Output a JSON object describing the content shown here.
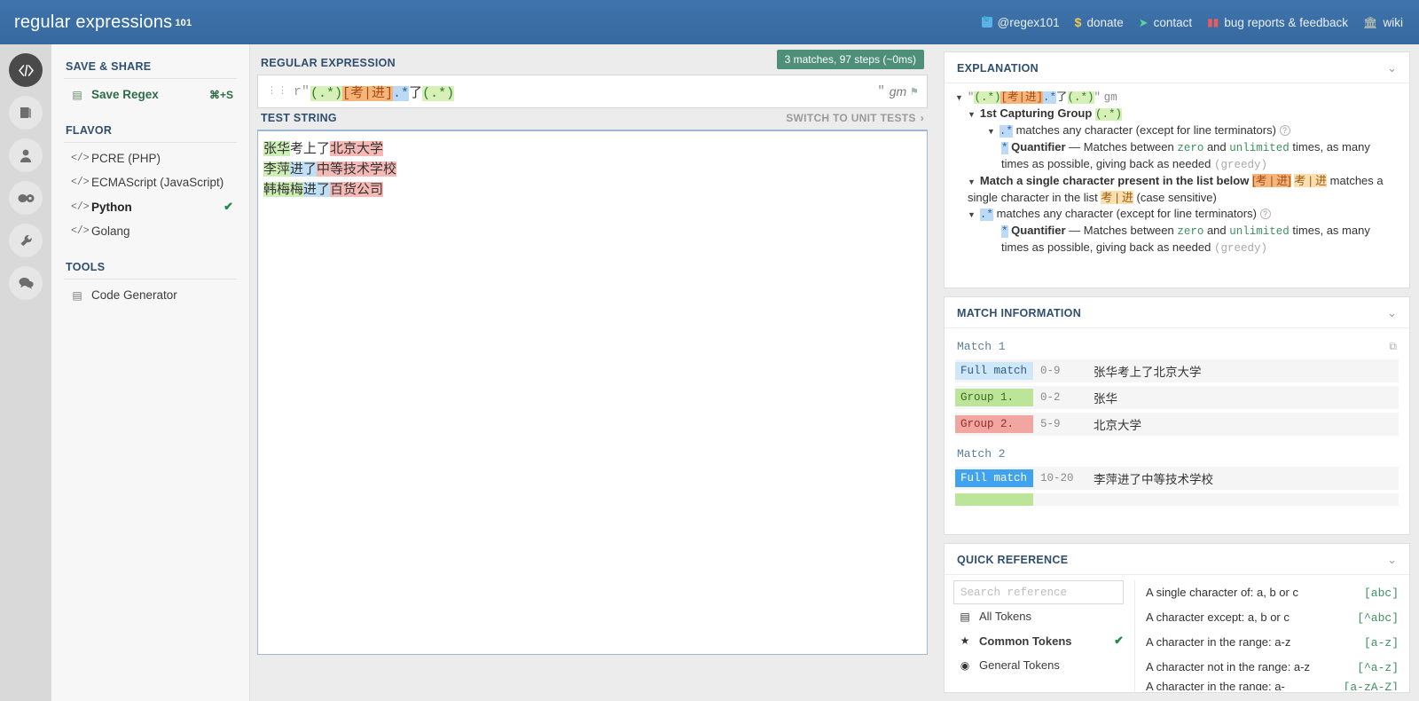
{
  "header": {
    "logo_left": "regular",
    "logo_right": "expressions",
    "logo_suffix": "101",
    "nav": [
      {
        "label": "@regex101",
        "icon": "twitter-icon"
      },
      {
        "label": "donate",
        "icon": "dollar-icon"
      },
      {
        "label": "contact",
        "icon": "paper-plane-icon"
      },
      {
        "label": "bug reports & feedback",
        "icon": "bug-icon"
      },
      {
        "label": "wiki",
        "icon": "bank-icon"
      }
    ]
  },
  "rail": {
    "items": [
      {
        "name": "regex-editor",
        "glyph": "</>"
      },
      {
        "name": "library",
        "glyph": "book"
      },
      {
        "name": "account",
        "glyph": "user"
      },
      {
        "name": "sponsor",
        "glyph": "link"
      },
      {
        "name": "settings",
        "glyph": "wrench"
      },
      {
        "name": "community",
        "glyph": "chat"
      }
    ]
  },
  "sidebar": {
    "save_share_title": "SAVE & SHARE",
    "save_regex_label": "Save Regex",
    "save_regex_shortcut": "⌘+S",
    "flavor_title": "FLAVOR",
    "flavors": [
      {
        "label": "PCRE (PHP)",
        "selected": false
      },
      {
        "label": "ECMAScript (JavaScript)",
        "selected": false
      },
      {
        "label": "Python",
        "selected": true
      },
      {
        "label": "Golang",
        "selected": false
      }
    ],
    "tools_title": "TOOLS",
    "tools": [
      {
        "label": "Code Generator"
      }
    ]
  },
  "center": {
    "regex_label": "REGULAR EXPRESSION",
    "match_badge": "3 matches, 97 steps (~0ms)",
    "regex_prefix": "r\"",
    "regex_suffix": "\"",
    "regex_flags": "gm",
    "regex_tokens": [
      {
        "text": "(.*)",
        "kind": "group"
      },
      {
        "text": "[考|进]",
        "kind": "class"
      },
      {
        "text": ".*",
        "kind": "dot"
      },
      {
        "text": "了",
        "kind": "literal"
      },
      {
        "text": "(.*)",
        "kind": "group"
      }
    ],
    "test_label": "TEST STRING",
    "switch_unit_tests": "SWITCH TO UNIT TESTS",
    "test_lines": [
      {
        "g1": "张华",
        "mid": "考上了",
        "mid_style": "plain",
        "g2": "北京大学"
      },
      {
        "g1": "李萍",
        "mid": "进了",
        "mid_style": "blue",
        "g2": "中等技术学校"
      },
      {
        "g1": "韩梅梅",
        "mid": "进了",
        "mid_style": "blue",
        "g2": "百货公司"
      }
    ]
  },
  "explanation": {
    "title": "EXPLANATION",
    "root_pattern_prefix": "\"",
    "root_pattern_suffix": "\"",
    "root_flags": "gm",
    "group1_label": "1st Capturing Group",
    "group1_token": "(.*)",
    "dot_token": ".*",
    "dot_desc": "matches any character (except for line terminators)",
    "quantifier_label": "Quantifier",
    "quantifier_desc_a": "— Matches between",
    "quantifier_zero": "zero",
    "quantifier_and": "and",
    "quantifier_unlimited": "unlimited",
    "quantifier_desc_b": "times, as many times as possible, giving back as needed",
    "greedy": "(greedy)",
    "class_heading": "Match a single character present in the list below",
    "class_token": "[考 | 进]",
    "class_inner": "考 | 进",
    "class_desc_a": "matches a single character in the list",
    "class_desc_b": "(case sensitive)",
    "quantifier2_desc_b": "times, as many times as possible, giving back as needed"
  },
  "match_information": {
    "title": "MATCH INFORMATION",
    "matches": [
      {
        "name": "Match 1",
        "rows": [
          {
            "tag": "Full match",
            "kind": "full",
            "range": "0-9",
            "value": "张华考上了北京大学",
            "hover": false
          },
          {
            "tag": "Group 1.",
            "kind": "g1",
            "range": "0-2",
            "value": "张华",
            "hover": false
          },
          {
            "tag": "Group 2.",
            "kind": "g2",
            "range": "5-9",
            "value": "北京大学",
            "hover": false
          }
        ]
      },
      {
        "name": "Match 2",
        "rows": [
          {
            "tag": "Full match",
            "kind": "full",
            "range": "10-20",
            "value": "李萍进了中等技术学校",
            "hover": true
          }
        ]
      }
    ]
  },
  "quick_reference": {
    "title": "QUICK REFERENCE",
    "search_placeholder": "Search reference",
    "search_value": "",
    "categories": [
      {
        "label": "All Tokens",
        "icon": "stack-icon",
        "selected": false
      },
      {
        "label": "Common Tokens",
        "icon": "star-icon",
        "selected": true
      },
      {
        "label": "General Tokens",
        "icon": "target-icon",
        "selected": false
      }
    ],
    "rows": [
      {
        "desc": "A single character of: a, b or c",
        "token": "[abc]"
      },
      {
        "desc": "A character except: a, b or c",
        "token": "[^abc]"
      },
      {
        "desc": "A character in the range: a-z",
        "token": "[a-z]"
      },
      {
        "desc": "A character not in the range: a-z",
        "token": "[^a-z]"
      },
      {
        "desc": "A character in the range: a-",
        "token": "[a-zA-Z]"
      }
    ]
  },
  "colors": {
    "brand_blue": "#3a6ea5",
    "badge_green": "#4e8f7a",
    "group_green": "#d7f0b8",
    "dot_blue": "#bcd9f5",
    "class_orange": "#f5b57a",
    "match_red": "#f6b9b6"
  }
}
